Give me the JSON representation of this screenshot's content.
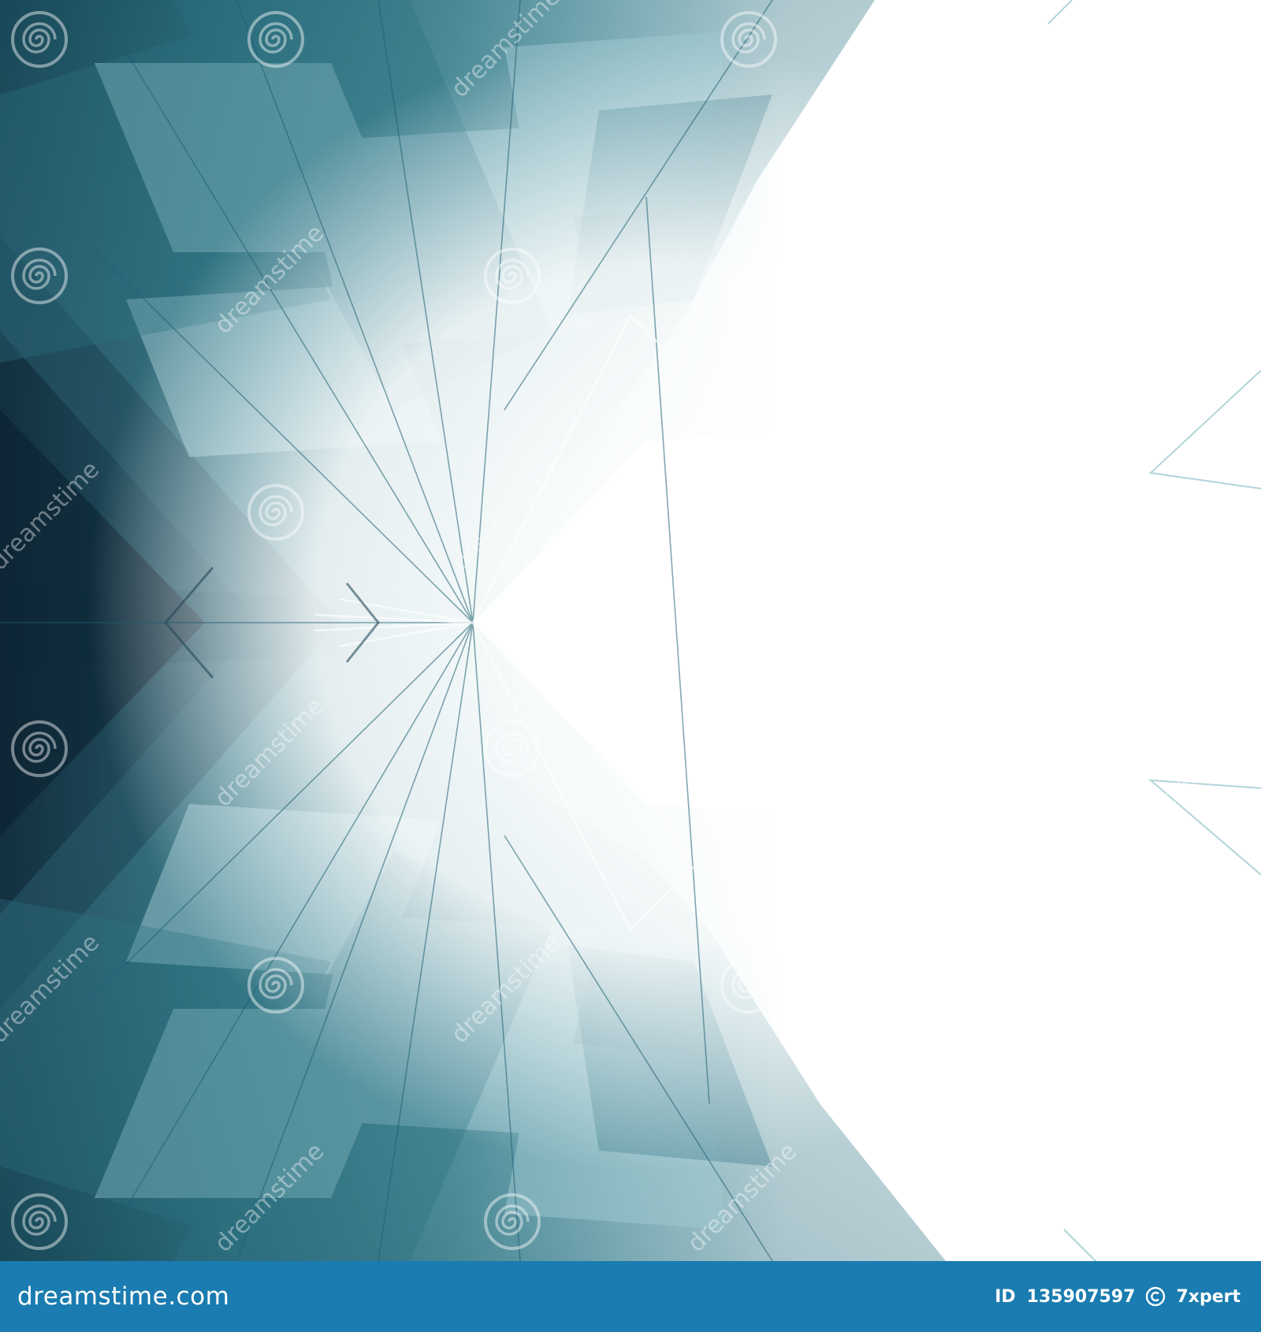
{
  "image": {
    "description_role": "abstract architecture background with teal glass planes converging to a white void",
    "colors": {
      "deep": "#0f2a3a",
      "teal": "#3f8a96",
      "mid": "#7fb8c2",
      "light": "#cfe6ea",
      "highlight": "#ffffff",
      "footer_bg": "#1a7cb0",
      "footer_text": "#ffffff"
    }
  },
  "watermark": {
    "text": "dreamstime",
    "icon": "spiral-icon"
  },
  "footer": {
    "brand": "dreamstime",
    "brand_suffix": ".com",
    "id_label": "ID",
    "id_number": "135907597",
    "copyright_icon": "copyright-icon",
    "author": "7xpert"
  }
}
